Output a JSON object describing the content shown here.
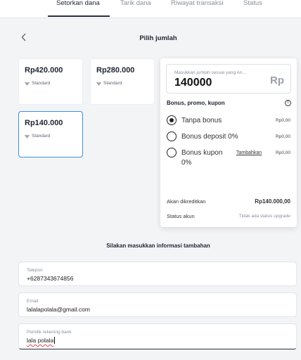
{
  "tabs": [
    {
      "label": "Setorkan dana",
      "active": true
    },
    {
      "label": "Tarik dana",
      "active": false
    },
    {
      "label": "Riwayat transaksi",
      "active": false
    },
    {
      "label": "Status",
      "active": false
    }
  ],
  "header": {
    "title": "Pilih jumlah",
    "back_icon": "chevron-left-icon"
  },
  "cards": [
    {
      "amount": "Rp420.000",
      "tag": "Standard",
      "selected": false
    },
    {
      "amount": "Rp280.000",
      "tag": "Standard",
      "selected": false
    },
    {
      "amount": "Rp140.000",
      "tag": "Standard",
      "selected": true
    }
  ],
  "panel": {
    "amount_hint": "Masukkan jumlah sesuai yang An...",
    "amount_value": "140000",
    "currency": "Rp",
    "bonus_heading": "Bonus, promo, kupon",
    "info_icon": "!",
    "options": [
      {
        "label": "Tanpa bonus",
        "value": "Rp0,00",
        "selected": true
      },
      {
        "label": "Bonus deposit 0%",
        "value": "Rp0,00",
        "selected": false
      },
      {
        "label_line1": "Bonus kupon",
        "label_line2": "0%",
        "link": "Tambahkan",
        "value": "Rp0,00",
        "selected": false
      }
    ],
    "credited_label": "Akan dikreditkan",
    "credited_value": "Rp140.000,00",
    "status_label": "Status akun",
    "status_value": "Tidak ada status upgrade"
  },
  "extra": {
    "title": "Silakan masukkan informasi tambahan",
    "fields": [
      {
        "label": "Telepon",
        "value": "+6287343674856"
      },
      {
        "label": "Email",
        "value": "lalalapolala@gmail.com"
      },
      {
        "label": "Pemilik rekening bank",
        "value": "lala polala"
      }
    ]
  },
  "colors": {
    "accent": "#3f8fe0",
    "background": "#f3f4f6"
  }
}
